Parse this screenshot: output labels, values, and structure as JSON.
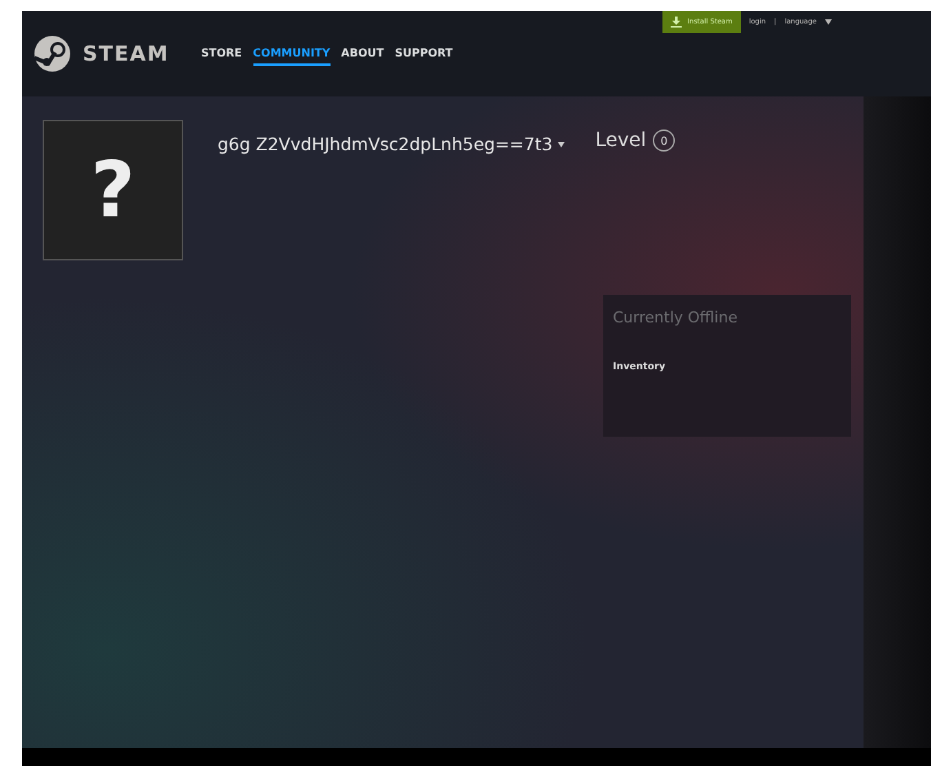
{
  "header": {
    "logo": "STEAM",
    "nav": [
      {
        "label": "STORE",
        "selected": false
      },
      {
        "label": "COMMUNITY",
        "selected": true
      },
      {
        "label": "ABOUT",
        "selected": false
      },
      {
        "label": "SUPPORT",
        "selected": false
      }
    ],
    "install_button": "Install Steam",
    "login": "login",
    "separator": "|",
    "language": "language"
  },
  "profile": {
    "avatar": "?",
    "name": "g6g Z2VvdHJhdmVsc2dpLnh5eg==7t3",
    "level_label": "Level",
    "level": "0"
  },
  "status_panel": {
    "status": "Currently Offline",
    "links": [
      "Inventory"
    ]
  }
}
